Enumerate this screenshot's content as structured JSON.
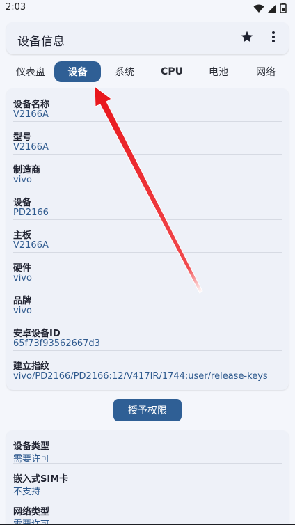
{
  "status_bar": {
    "time": "2:03",
    "icons": [
      "wifi-icon",
      "signal-icon",
      "battery-icon"
    ]
  },
  "app_bar": {
    "title": "设备信息",
    "actions": [
      "star-icon",
      "more-vert-icon"
    ]
  },
  "tabs": [
    {
      "label": "仪表盘",
      "active": false
    },
    {
      "label": "设备",
      "active": true
    },
    {
      "label": "系统",
      "active": false
    },
    {
      "label": "CPU",
      "active": false
    },
    {
      "label": "电池",
      "active": false
    },
    {
      "label": "网络",
      "active": false
    }
  ],
  "device_info": [
    {
      "label": "设备名称",
      "value": "V2166A"
    },
    {
      "label": "型号",
      "value": "V2166A"
    },
    {
      "label": "制造商",
      "value": "vivo"
    },
    {
      "label": "设备",
      "value": "PD2166"
    },
    {
      "label": "主板",
      "value": "V2166A"
    },
    {
      "label": "硬件",
      "value": "vivo"
    },
    {
      "label": "品牌",
      "value": "vivo"
    },
    {
      "label": "安卓设备ID",
      "value": "65f73f93562667d3"
    },
    {
      "label": "建立指纹",
      "value": "vivo/PD2166/PD2166:12/V417IR/1744:user/release-keys"
    }
  ],
  "grant_button_label": "授予权限",
  "permission_info": [
    {
      "label": "设备类型",
      "value": "需要许可"
    },
    {
      "label": "嵌入式SIM卡",
      "value": "不支持"
    },
    {
      "label": "网络类型",
      "value": "需要许可"
    }
  ],
  "colors": {
    "accent": "#2f5f95",
    "value_text": "#2f5a8e",
    "card_bg": "#eef1f8",
    "page_bg": "#f4f6fb",
    "annotation_arrow": "#e8141a"
  }
}
